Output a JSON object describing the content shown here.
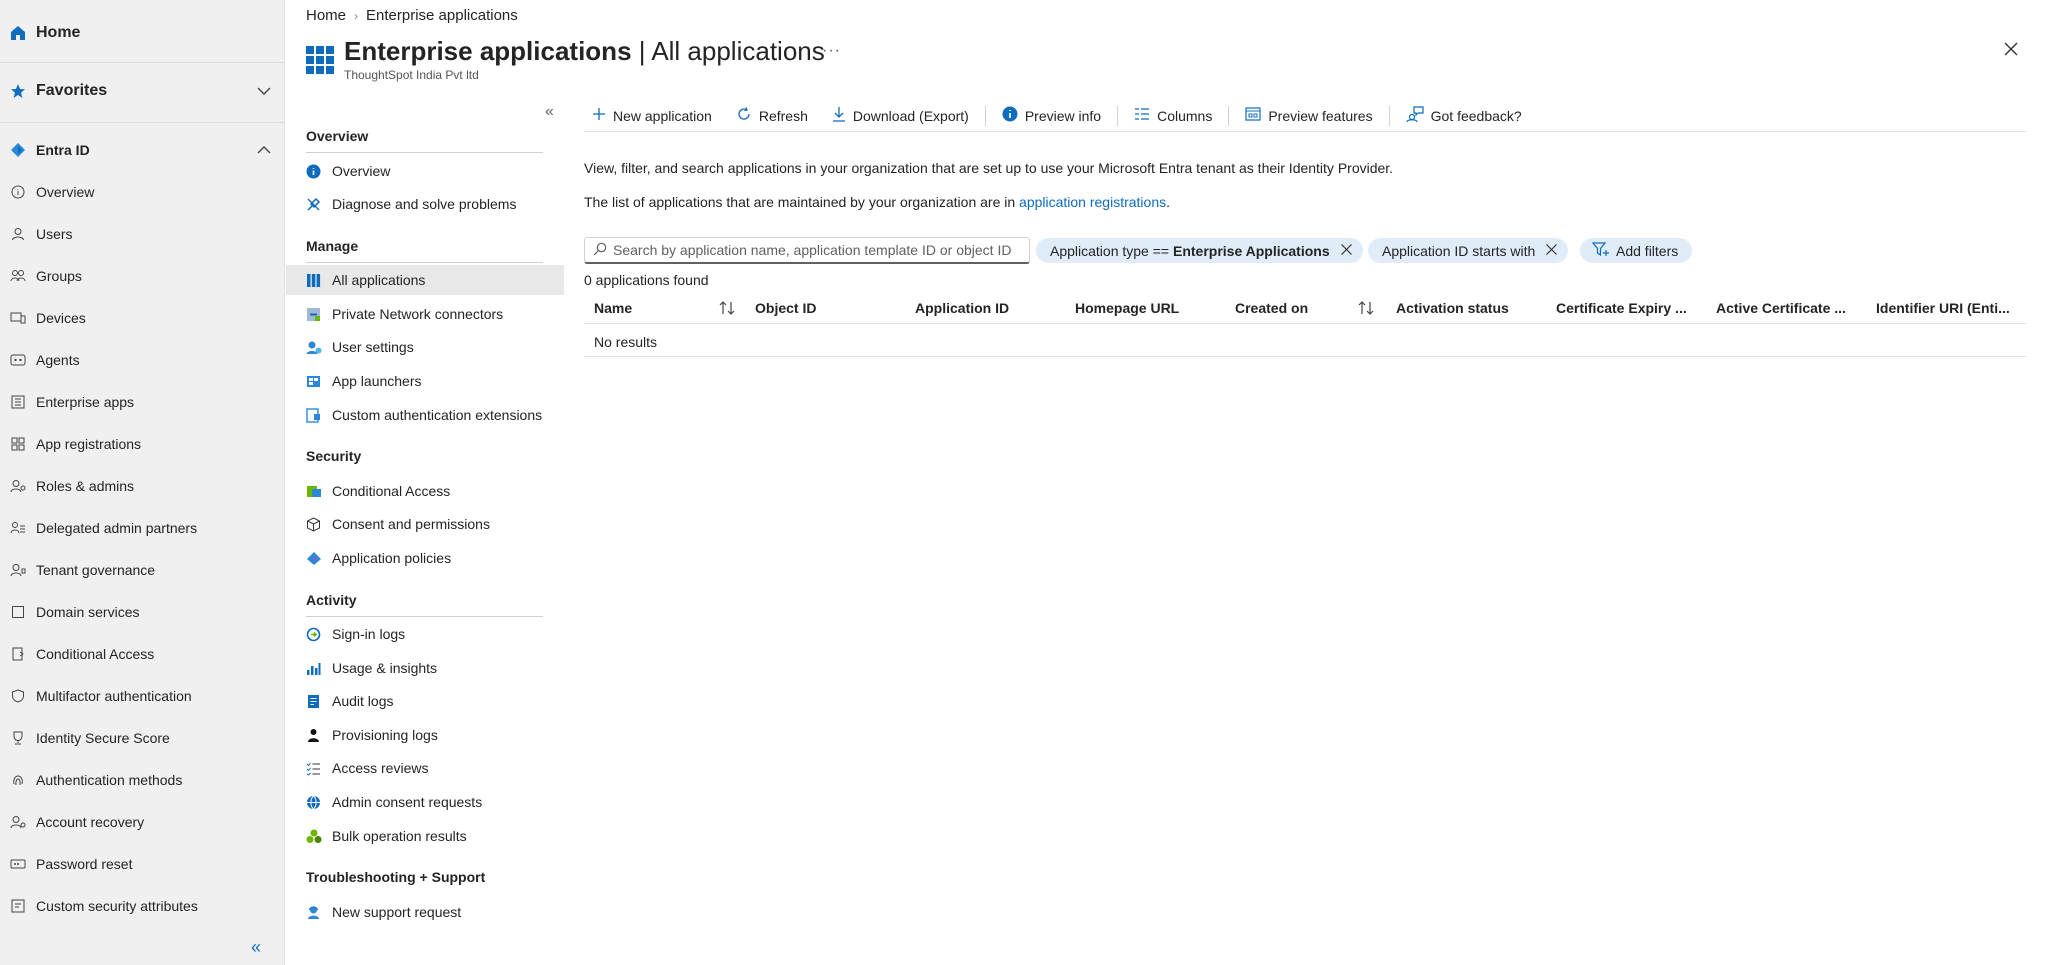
{
  "leftnav": {
    "home": "Home",
    "favorites": "Favorites",
    "entra": "Entra ID",
    "items": [
      "Overview",
      "Users",
      "Groups",
      "Devices",
      "Agents",
      "Enterprise apps",
      "App registrations",
      "Roles & admins",
      "Delegated admin partners",
      "Tenant governance",
      "Domain services",
      "Conditional Access",
      "Multifactor authentication",
      "Identity Secure Score",
      "Authentication methods",
      "Account recovery",
      "Password reset",
      "Custom security attributes"
    ]
  },
  "breadcrumb": {
    "home": "Home",
    "current": "Enterprise applications"
  },
  "header": {
    "title_main": "Enterprise applications",
    "title_sep": " | ",
    "title_sub": "All applications",
    "tenant": "ThoughtSpot India Pvt ltd",
    "more": "···"
  },
  "secnav": {
    "collapse": "«",
    "sections": {
      "overview": "Overview",
      "manage": "Manage",
      "security": "Security",
      "activity": "Activity",
      "support": "Troubleshooting + Support"
    },
    "items": {
      "overview": "Overview",
      "diagnose": "Diagnose and solve problems",
      "all_apps": "All applications",
      "private_net": "Private Network connectors",
      "user_settings": "User settings",
      "app_launchers": "App launchers",
      "custom_auth": "Custom authentication extensions",
      "cond_access": "Conditional Access",
      "consent": "Consent and permissions",
      "app_policies": "Application policies",
      "signin": "Sign-in logs",
      "usage": "Usage & insights",
      "audit": "Audit logs",
      "provisioning": "Provisioning logs",
      "access_reviews": "Access reviews",
      "admin_consent": "Admin consent requests",
      "bulk": "Bulk operation results",
      "new_support": "New support request"
    }
  },
  "toolbar": {
    "new_app": "New application",
    "refresh": "Refresh",
    "download": "Download (Export)",
    "preview_info": "Preview info",
    "columns": "Columns",
    "preview_features": "Preview features",
    "feedback": "Got feedback?"
  },
  "main": {
    "desc1": "View, filter, and search applications in your organization that are set up to use your Microsoft Entra tenant as their Identity Provider.",
    "desc2_prefix": "The list of applications that are maintained by your organization are in ",
    "desc2_link": "application registrations",
    "desc2_suffix": ".",
    "search_placeholder": "Search by application name, application template ID or object ID",
    "search_value": "",
    "filter1_prefix": "Application type == ",
    "filter1_value": "Enterprise Applications",
    "filter2": "Application ID starts with",
    "add_filters": "Add filters",
    "count": "0 applications found",
    "no_results": "No results"
  },
  "table": {
    "columns": [
      "Name",
      "Object ID",
      "Application ID",
      "Homepage URL",
      "Created on",
      "Activation status",
      "Certificate Expiry ...",
      "Active Certificate ...",
      "Identifier URI (Enti..."
    ]
  },
  "colors": {
    "accent": "#0f6cbd",
    "nav_bg": "#f0f0f0",
    "pill_bg": "#e0ecf8"
  }
}
